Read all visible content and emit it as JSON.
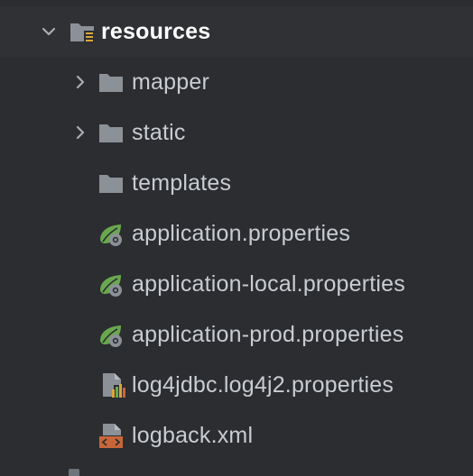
{
  "tree": {
    "root": {
      "label": "resources",
      "expanded": true,
      "icon": "resources-folder-icon"
    },
    "items": [
      {
        "label": "mapper",
        "type": "folder",
        "expandable": true,
        "icon": "folder-icon"
      },
      {
        "label": "static",
        "type": "folder",
        "expandable": true,
        "icon": "folder-icon"
      },
      {
        "label": "templates",
        "type": "folder",
        "expandable": false,
        "icon": "folder-icon"
      },
      {
        "label": "application.properties",
        "type": "file",
        "icon": "spring-properties-icon"
      },
      {
        "label": "application-local.properties",
        "type": "file",
        "icon": "spring-properties-icon"
      },
      {
        "label": "application-prod.properties",
        "type": "file",
        "icon": "spring-properties-icon"
      },
      {
        "label": "log4jdbc.log4j2.properties",
        "type": "file",
        "icon": "properties-file-icon"
      },
      {
        "label": "logback.xml",
        "type": "file",
        "icon": "xml-file-icon"
      }
    ]
  },
  "colors": {
    "background": "#2b2d30",
    "text": "#c9ccd1",
    "folder": "#8c9097",
    "spring_green": "#6aa84f",
    "xml_orange": "#c8663a"
  }
}
